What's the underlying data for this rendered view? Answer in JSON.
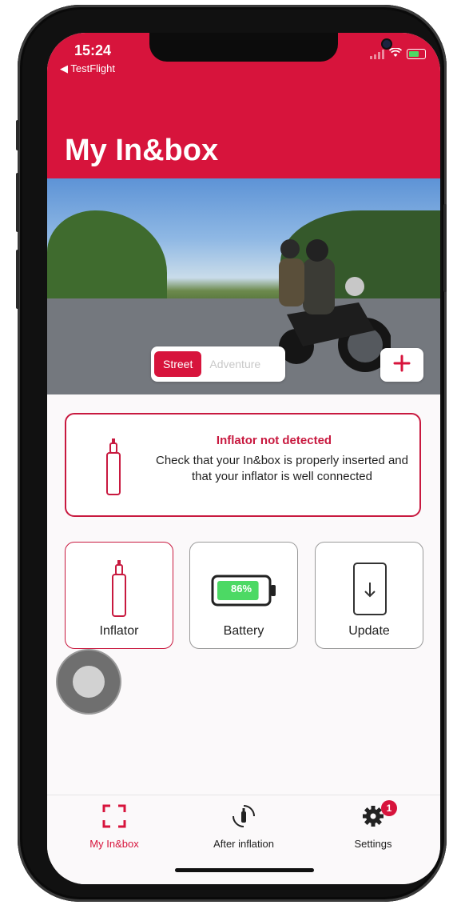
{
  "status_bar": {
    "time": "15:24",
    "back_label": "◀ TestFlight"
  },
  "header": {
    "title": "My In&box"
  },
  "mode_selector": {
    "options": [
      "Street",
      "Adventure"
    ],
    "selected": "Street"
  },
  "add_button": {
    "label": "+"
  },
  "alert": {
    "title": "Inflator not detected",
    "message": "Check that your In&box is properly inserted and that your inflator is well connected"
  },
  "tiles": {
    "inflator": {
      "label": "Inflator"
    },
    "battery": {
      "label": "Battery",
      "level_text": "86%",
      "level_percent": 86
    },
    "update": {
      "label": "Update"
    }
  },
  "tabbar": {
    "tabs": [
      {
        "label": "My In&box",
        "icon": "scan-frame-icon",
        "active": true
      },
      {
        "label": "After inflation",
        "icon": "inflation-cycle-icon",
        "active": false
      },
      {
        "label": "Settings",
        "icon": "gear-icon",
        "active": false,
        "badge": "1"
      }
    ]
  },
  "colors": {
    "brand": "#d7143c",
    "battery_fill": "#4cd964"
  }
}
